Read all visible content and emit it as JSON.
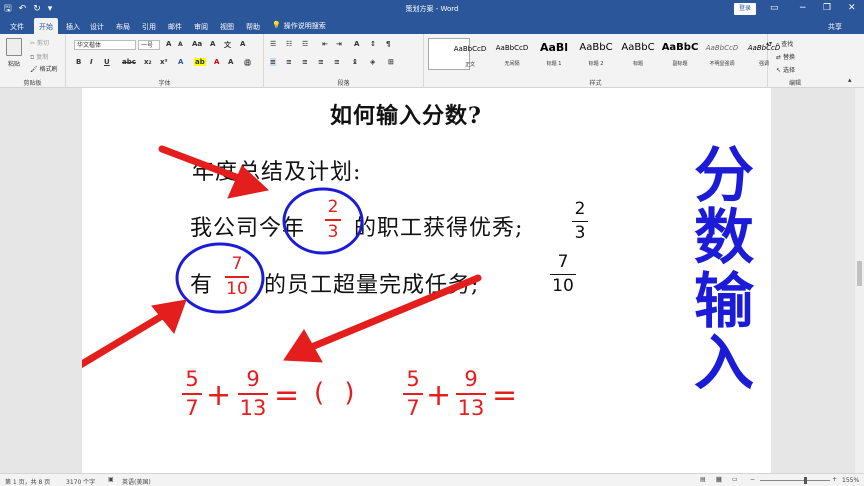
{
  "titlebar": {
    "title": "策划方案 - Word",
    "login_label": "登录",
    "window_buttons": [
      "▭",
      "−",
      "❐",
      "✕"
    ]
  },
  "tabs": {
    "items": [
      "文件",
      "开始",
      "插入",
      "设计",
      "布局",
      "引用",
      "邮件",
      "审阅",
      "视图",
      "帮助"
    ],
    "active": "开始",
    "help_search": "操作说明搜索",
    "share": "共享"
  },
  "ribbon": {
    "clipboard": {
      "paste": "粘贴",
      "cut": "剪切",
      "copy": "复制",
      "format_painter": "格式刷",
      "label": "剪贴板"
    },
    "font": {
      "family": "华文楷体",
      "size": "一号",
      "label": "字体"
    },
    "paragraph": {
      "label": "段落"
    },
    "styles": {
      "label": "样式",
      "items": [
        {
          "preview": "AaBbCcD",
          "name": "正文"
        },
        {
          "preview": "AaBbCcD",
          "name": "无间隔"
        },
        {
          "preview": "AaBl",
          "name": "标题 1"
        },
        {
          "preview": "AaBbC",
          "name": "标题 2"
        },
        {
          "preview": "AaBbC",
          "name": "标题"
        },
        {
          "preview": "AaBbC",
          "name": "副标题"
        },
        {
          "preview": "AaBbCcD",
          "name": "不明显强调"
        },
        {
          "preview": "AaBbCcD",
          "name": "强调"
        }
      ]
    },
    "editing": {
      "find": "查找",
      "replace": "替换",
      "select": "选择",
      "label": "编辑"
    }
  },
  "document": {
    "heading": "如何输入分数?",
    "line1": "年度总结及计划:",
    "line2_prefix": "我公司今年",
    "line2_suffix": "的职工获得优秀;",
    "line3_prefix": "有",
    "line3_suffix": "的员工超量完成任务;",
    "fractions": {
      "two_thirds": {
        "num": "2",
        "den": "3"
      },
      "seven_tenths": {
        "num": "7",
        "den": "10"
      },
      "five_sevenths": {
        "num": "5",
        "den": "7"
      },
      "nine_thirteenths": {
        "num": "9",
        "den": "13"
      }
    },
    "plus": "+",
    "equals": "=",
    "blank": "( )",
    "side_title": [
      "分",
      "数",
      "输",
      "入"
    ]
  },
  "status": {
    "page": "第 1 页，共 8 页",
    "words": "3170 个字",
    "language": "英语(美国)",
    "zoom": "155%"
  },
  "colors": {
    "accent": "#2b579a",
    "annotation_red": "#e41d1d",
    "annotation_blue": "#1c1cd8"
  }
}
